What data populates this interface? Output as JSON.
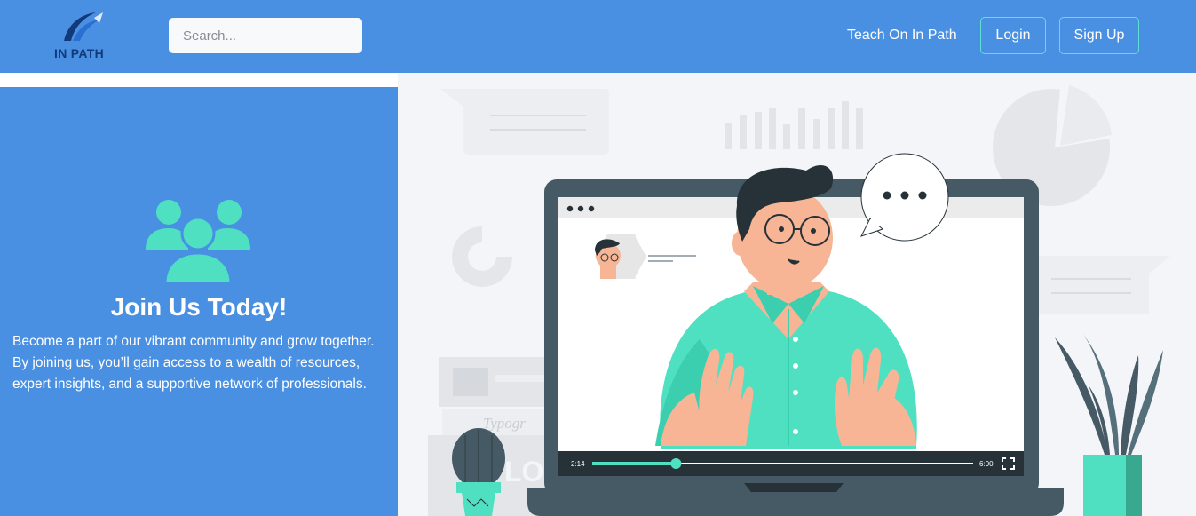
{
  "header": {
    "logo_text": "IN PATH",
    "search_placeholder": "Search...",
    "teach_link": "Teach On In Path",
    "login_label": "Login",
    "signup_label": "Sign Up"
  },
  "join_panel": {
    "title": "Join Us Today!",
    "description": "Become a part of our vibrant community and grow together. By joining us, you’ll gain access to a wealth of resources, expert insights, and a supportive network of professionals."
  },
  "illustration": {
    "video_current_time": "2:14",
    "video_total_time": "6:00",
    "video_progress": 0.22,
    "book_text": "Typogr"
  },
  "colors": {
    "primary": "#4a90e2",
    "accent": "#4fe0c2",
    "dark": "#455a64",
    "logo_dark": "#123a7a"
  }
}
